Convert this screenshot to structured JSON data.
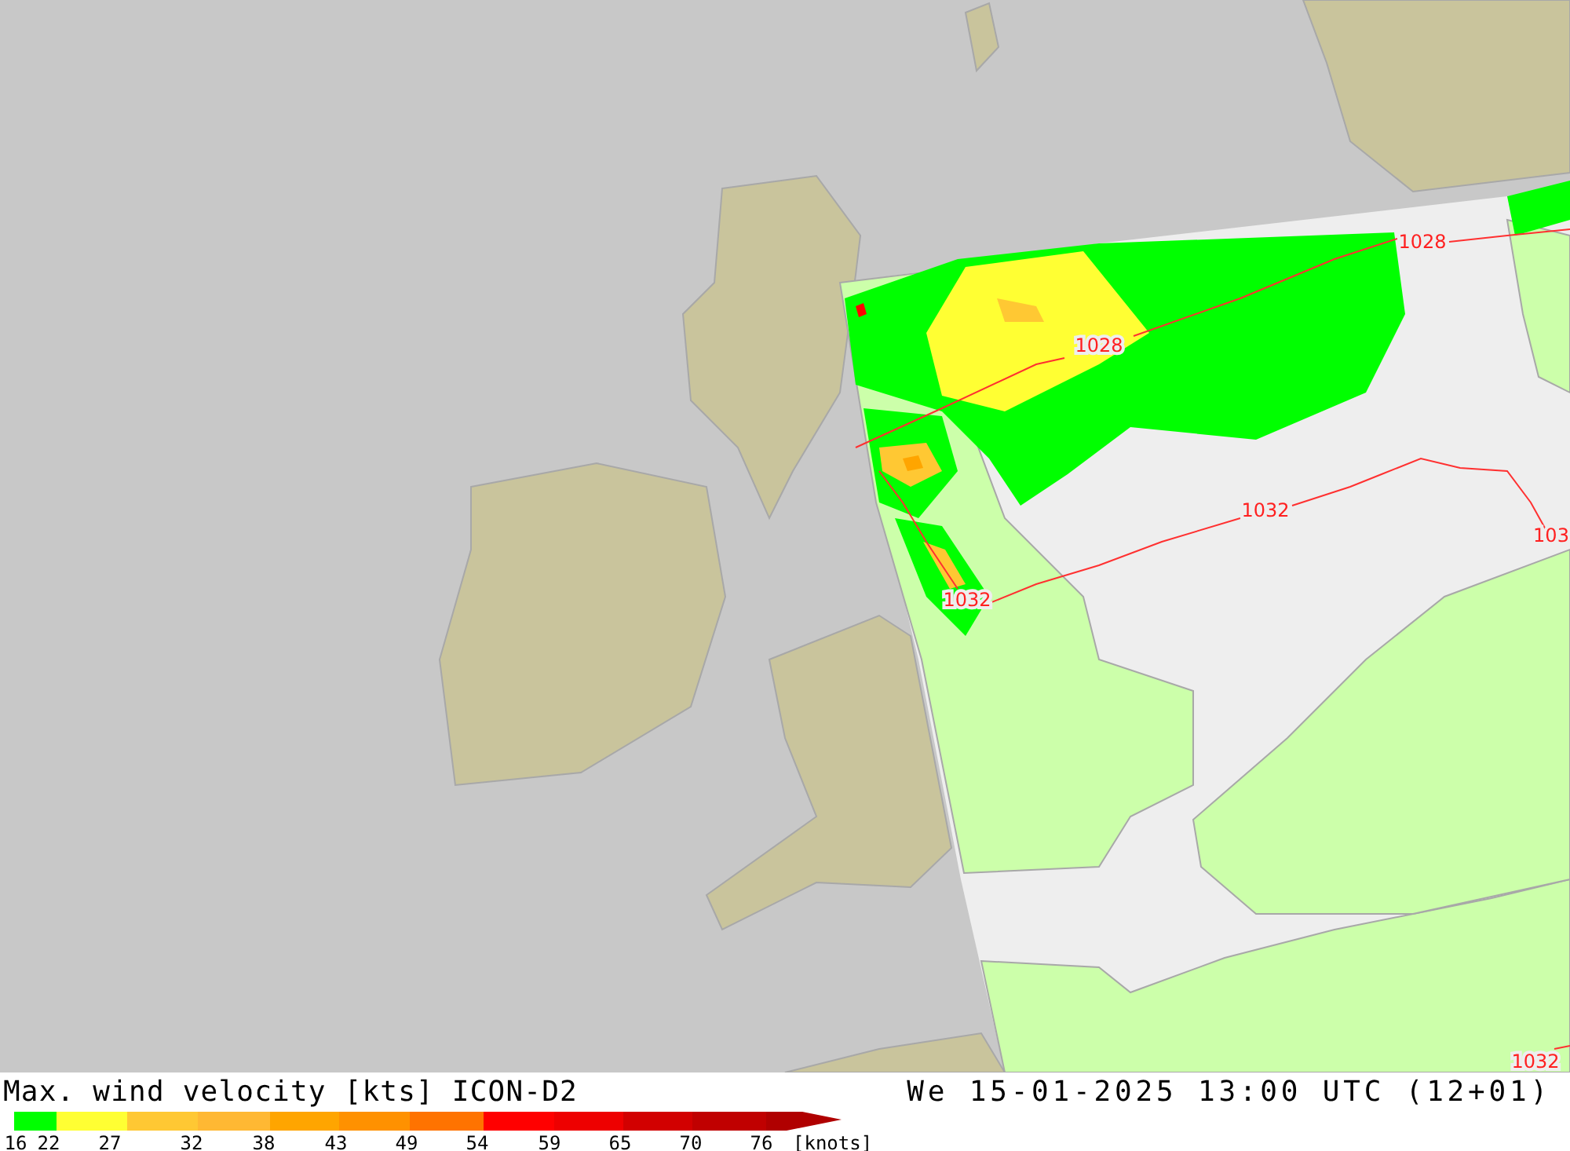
{
  "title": "Max. wind velocity [kts] ICON-D2",
  "datetime": "We 15-01-2025 13:00 UTC (12+01)",
  "map": {
    "isobars": [
      {
        "label": "1028"
      },
      {
        "label": "1028"
      },
      {
        "label": "1032"
      },
      {
        "label": "1032"
      },
      {
        "label": "103"
      },
      {
        "label": "1032"
      }
    ]
  },
  "legend": {
    "bins": [
      {
        "color": "#00ff00"
      },
      {
        "color": "#ffff33"
      },
      {
        "color": "#ffc833"
      },
      {
        "color": "#ffb833"
      },
      {
        "color": "#ffa500"
      },
      {
        "color": "#ff9100"
      },
      {
        "color": "#ff7300"
      },
      {
        "color": "#ff0000"
      },
      {
        "color": "#ee0000"
      },
      {
        "color": "#d20000"
      },
      {
        "color": "#c00000"
      },
      {
        "color": "#b00000"
      }
    ],
    "ticks": [
      "16",
      "22",
      "27",
      "32",
      "38",
      "43",
      "49",
      "54",
      "59",
      "65",
      "70",
      "76"
    ],
    "unit": "[knots]"
  }
}
